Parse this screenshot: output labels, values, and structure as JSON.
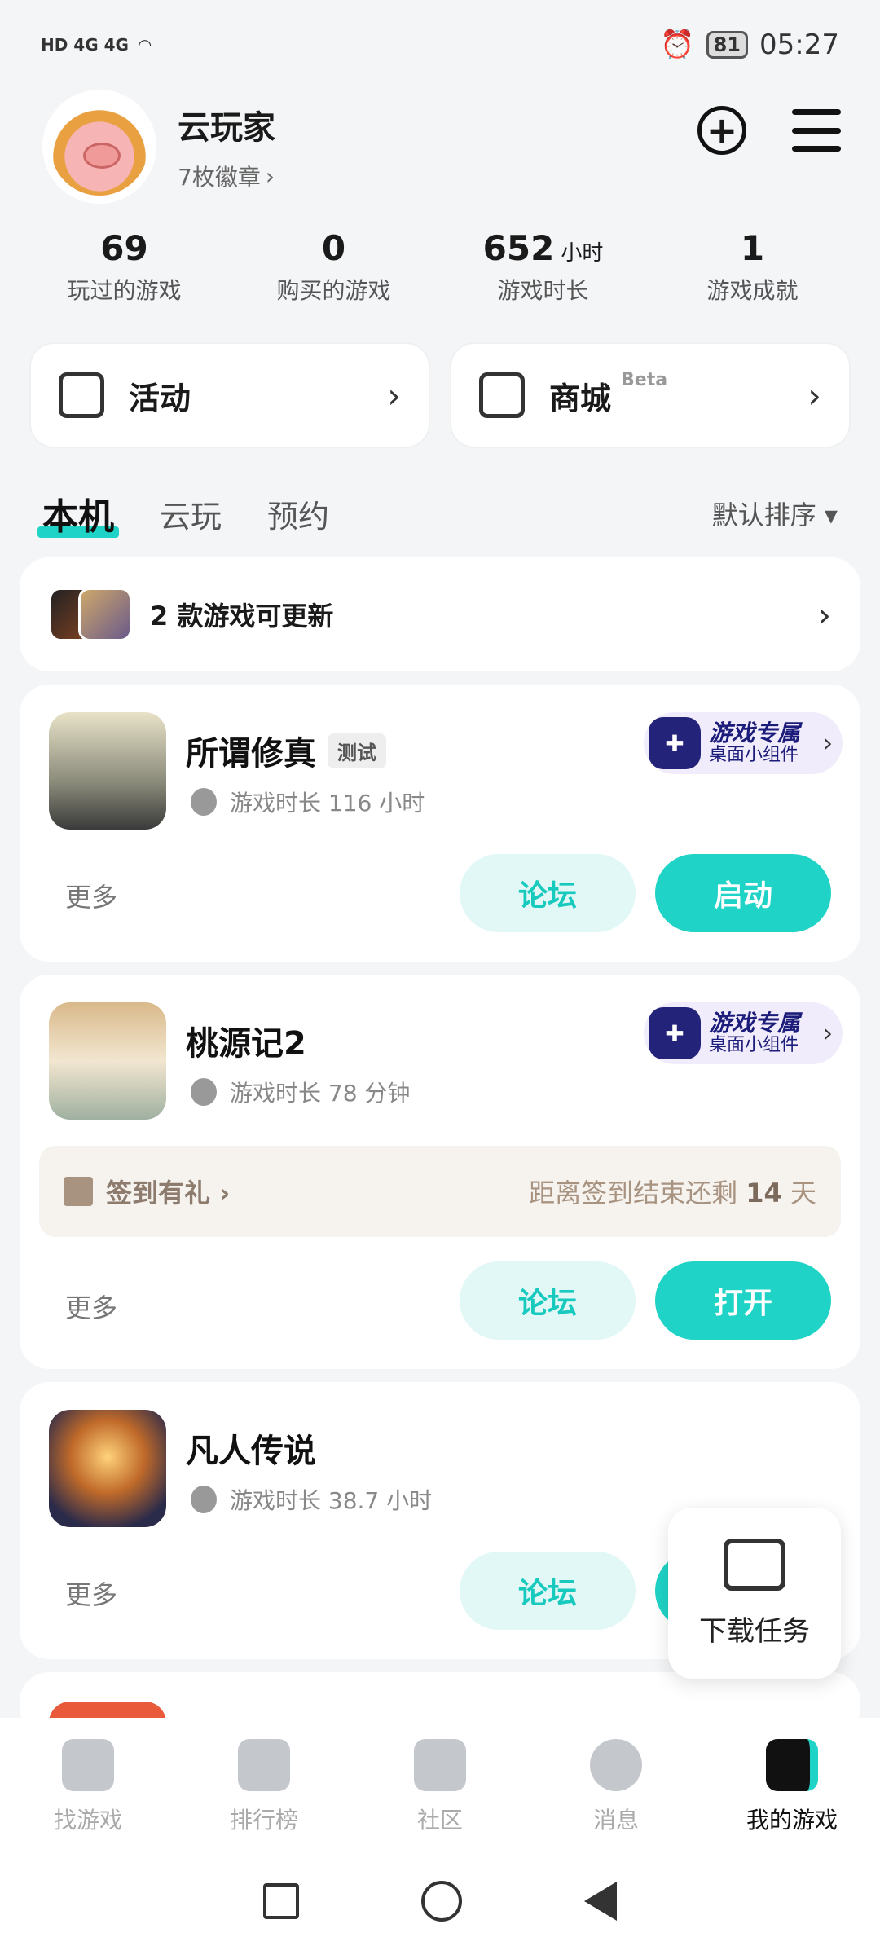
{
  "status_bar": {
    "time": "05:27",
    "battery": "81",
    "left_labels": "HD 4G 4G"
  },
  "profile": {
    "username": "云玩家",
    "badges": "7枚徽章",
    "badges_chevron": "›"
  },
  "stats": [
    {
      "value": "69",
      "unit": "",
      "label": "玩过的游戏"
    },
    {
      "value": "0",
      "unit": "",
      "label": "购买的游戏"
    },
    {
      "value": "652",
      "unit": "小时",
      "label": "游戏时长"
    },
    {
      "value": "1",
      "unit": "",
      "label": "游戏成就"
    }
  ],
  "actions": {
    "activity": "活动",
    "store": "商城",
    "store_beta": "Beta",
    "chevron": "›"
  },
  "tabs": {
    "local": "本机",
    "cloud": "云玩",
    "reserve": "预约",
    "sort": "默认排序 ▾"
  },
  "update": {
    "text": "2 款游戏可更新",
    "chevron": "›"
  },
  "widget": {
    "title": "游戏专属",
    "subtitle": "桌面小组件",
    "chevron": "›"
  },
  "games": [
    {
      "name": "所谓修真",
      "tag": "测试",
      "playtime": "游戏时长 116 小时",
      "more": "更多",
      "forum": "论坛",
      "action": "启动"
    },
    {
      "name": "桃源记2",
      "playtime": "游戏时长 78 分钟",
      "more": "更多",
      "forum": "论坛",
      "action": "打开",
      "checkin": {
        "label": "签到有礼 ›",
        "remaining_prefix": "距离签到结束还剩 ",
        "remaining_days": "14",
        "remaining_suffix": " 天"
      }
    },
    {
      "name": "凡人传说",
      "playtime": "游戏时长 38.7 小时",
      "more": "更多",
      "forum": "论坛"
    }
  ],
  "download_float": {
    "label": "下载任务"
  },
  "bottom_nav": [
    {
      "label": "找游戏",
      "icon": "find-games-icon"
    },
    {
      "label": "排行榜",
      "icon": "ranking-icon"
    },
    {
      "label": "社区",
      "icon": "community-icon"
    },
    {
      "label": "消息",
      "icon": "messages-icon"
    },
    {
      "label": "我的游戏",
      "icon": "my-games-icon"
    }
  ],
  "colors": {
    "accent": "#1fd3c6",
    "widget": "#1c1c7a"
  }
}
